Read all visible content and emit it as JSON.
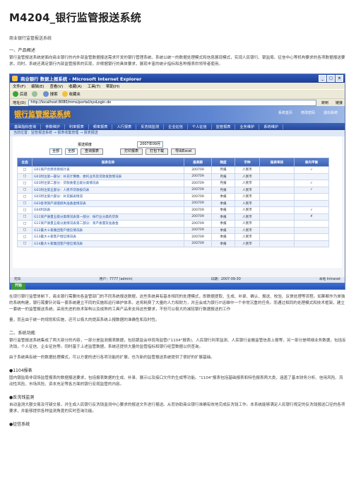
{
  "doc": {
    "title": "M4204_银行监管报送系统",
    "subtitle": "商业银行监管报送系统",
    "section1": "一、产品概述",
    "para1": "银行监管报送系统是面向商业银行的内外部监管数据报送需求开发的银行管理系统。系统以统一的数据处理模式和信息展现模式，实现人民银行、银监局、征信中心等机构要求的各项数据报送要求。同时，系统还满足银行内部监管报表的实现，并根据银行的具体要求，展现丰富的统计指标和各种报表供领导者使用。",
    "para2": "在现行银行监管体制下，商业银行需要向各监管部门的不同系统报送数据，这些系统具有基本相同的处理模式，即数据提取、生成、补录、确认、报送、校验、反馈处理等流程。如果都作为单独的系统构建，银行需要针对每一套系统建立不同的实施和运行维护体系，这将耗费了大量的人力和财力，并且会成为银行IT运维中一个非常沉重的任务。而通过相同的处理模式和技术框架，建立一套统一的监管报送系统，采用先进的技术架构以及成熟的工具产品来支持这些要求，不但可以极大的减轻银行数据报送的工作",
    "para3": "量，而且由于统一的规划和实施，还可以极大的提高系统上报数据的准确性和及时性。",
    "section2": "二、系统功能",
    "para4": "银行监管报送系统集成了两大部分的内容，一部分是监测报表数据，包括银监会非现场监管(\"1104\"报表)、人民银行利率监测、人民银行金融监管信息上报等，另一部分是明细业务数据，包括反洗钱，个人征信、企业征信等。同时基于上述监管数据，系统还提供大量的监管指标和银行经营数据以供查询。",
    "para5": "由于系统具有统一的数据处理模式，可以方便的进行各项功能的扩展，也为新的监管报送系统提供了很好的扩展基础。",
    "bullet1": "●1104报表",
    "para6": "国内银监局非现场监管报表的数据报送要求，包括报表数据的生成、补录、展示以及接口文件的生成等功能。\"1104\"报表包括基础报表和特色报表两大类，涵盖了基本财务分析、信用风险、流动性风险、市场风险、资本充足等各方面的银行宏观监管的内容。",
    "bullet2": "●反洗钱监测",
    "para7": "自动监测大额交易及可疑交易，并生成人民银行反洗钱监测中心要求的报送文件进行报送。从而协助商业银行准确有效地完成反洗钱工作。本系统能够满足人民银行规定的反洗钱报送口径的各项要求，并能够提供各种监测角度的实时查询功能。",
    "bullet3": "●征信系统"
  },
  "shot": {
    "window_title": "商业银行 数据上报系统 - Microsoft Internet Explorer",
    "menu": [
      "文件(F)",
      "编辑(E)",
      "查看(V)",
      "收藏(A)",
      "工具(T)",
      "帮助(H)"
    ],
    "toolbar": [
      "后退",
      "搜索",
      "收藏夹"
    ],
    "address_label": "地址(D)",
    "address_value": "http://localhost:8080/mms/portal/sysLogin.do",
    "go_label": "转到",
    "links_label": "链接",
    "logo": "银行监管报送系统",
    "logo_sub": "BANK REGULATORY REPORTING SYSTEM",
    "banner_links": [
      "系统首页",
      "修改密码",
      "退出系统"
    ],
    "nav": [
      "基础指标查询",
      "参数维护",
      "利率报表",
      "频率报表",
      "人行报表",
      "反洗钱监测",
      "企业征信",
      "个人征信",
      "监管报表",
      "业务维护",
      "系统维护"
    ],
    "crumb": "当前位置：监管报送系统 → 报表收集管理 → 报表报送",
    "filter_label": "报送频度",
    "filter_period": "2007年09月",
    "filter_all1": "全部",
    "filter_all2": "全部",
    "btn_query": "查询报表",
    "btn_all": "打印报表",
    "btn_print": "打包下载",
    "btn_excel": "导出Excel",
    "columns": [
      "全选",
      "报表名称",
      "报表期",
      "频度",
      "币种",
      "报表审核",
      "表内平衡"
    ],
    "rows": [
      [
        "G01资产负债项目统计表",
        "200709",
        "月报",
        "人民币",
        "",
        "✓"
      ],
      [
        "G01附注第一部分：补充计算数、委托业务及贷款发放情况表",
        "200709",
        "月报",
        "人民币",
        "",
        ""
      ],
      [
        "G01附注第二部分：贷款质量五级分类情况表",
        "200709",
        "月报",
        "人民币",
        "",
        "✓"
      ],
      [
        "G01附注第五部分：人民币贷款投向表",
        "200709",
        "月报",
        "人民币",
        "",
        "✓"
      ],
      [
        "G01附注第六部分：补充报表情况",
        "200709",
        "季报",
        "人民币",
        "",
        ""
      ],
      [
        "G03各项资产减值损失准备金情况表",
        "200709",
        "季报",
        "人民币",
        "",
        ""
      ],
      [
        "G04利润表",
        "200709",
        "季报",
        "人民币",
        "",
        "✓"
      ],
      [
        "G11资产质量五级分类情况表第一部分：按行业分类的贷款",
        "200709",
        "季报",
        "人民币",
        "",
        "✗"
      ],
      [
        "G11资产质量五级分类情况表第二部分：资产质量及准备金",
        "200709",
        "季报",
        "人民币",
        "",
        ""
      ],
      [
        "G12最大十家集团客户授信情况表",
        "200709",
        "季报",
        "人民币",
        "",
        ""
      ],
      [
        "G13最大十家客户授信情况表",
        "200709",
        "季报",
        "人民币",
        "",
        ""
      ],
      [
        "G14最大十家集团客户授信情况表",
        "200709",
        "季报",
        "人民币",
        "",
        ""
      ]
    ],
    "status_left": "完毕",
    "status_user": "用户：7777 (admin)",
    "status_date": "日期：2007-09-30",
    "status_right": "本地 Intranet",
    "start_label": "开始"
  }
}
